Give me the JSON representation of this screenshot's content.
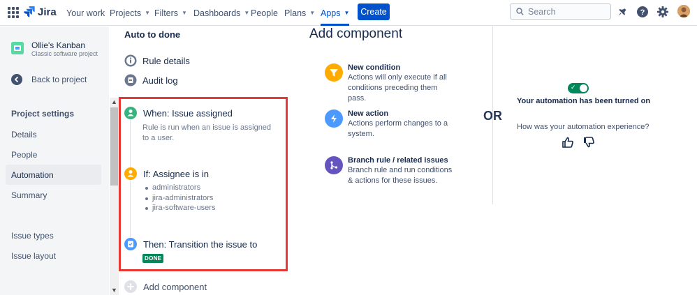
{
  "nav": {
    "logo": "Jira",
    "items": [
      {
        "label": "Your work",
        "dropdown": false
      },
      {
        "label": "Projects",
        "dropdown": true
      },
      {
        "label": "Filters",
        "dropdown": true
      },
      {
        "label": "Dashboards",
        "dropdown": true
      },
      {
        "label": "People",
        "dropdown": false
      },
      {
        "label": "Plans",
        "dropdown": true
      },
      {
        "label": "Apps",
        "dropdown": true,
        "active": true
      }
    ],
    "create_label": "Create",
    "search_placeholder": "Search",
    "accent_color": "#0052CC"
  },
  "sidebar": {
    "project_name": "Ollie's Kanban",
    "project_type": "Classic software project",
    "back_label": "Back to project",
    "heading": "Project settings",
    "items": [
      {
        "label": "Details"
      },
      {
        "label": "People"
      },
      {
        "label": "Automation",
        "selected": true
      },
      {
        "label": "Summary"
      },
      {
        "label": "Issue types"
      },
      {
        "label": "Issue layout"
      }
    ]
  },
  "rule": {
    "title": "Auto to done",
    "details_label": "Rule details",
    "audit_label": "Audit log",
    "trigger": {
      "title": "When: Issue assigned",
      "description": "Rule is run when an issue is assigned to a user."
    },
    "condition": {
      "title": "If: Assignee is in",
      "groups": [
        "administrators",
        "jira-administrators",
        "jira-software-users"
      ]
    },
    "action": {
      "title": "Then: Transition the issue to",
      "status": "DONE"
    },
    "add_component_label": "Add component",
    "highlight_color": "#E53935"
  },
  "add_component": {
    "title": "Add component",
    "options": [
      {
        "title": "New condition",
        "description": "Actions will only execute if all conditions preceding them pass.",
        "icon": "filter-icon",
        "color": "#FFAB00"
      },
      {
        "title": "New action",
        "description": "Actions perform changes to a system.",
        "icon": "lightning-icon",
        "color": "#4C9AFF"
      },
      {
        "title": "Branch rule / related issues",
        "description": "Branch rule and run conditions & actions for these issues.",
        "icon": "branch-icon",
        "color": "#6554C0"
      }
    ],
    "or_label": "OR"
  },
  "feedback": {
    "status": "Your automation has been turned on",
    "question": "How was your automation experience?",
    "toggle_on": true,
    "toggle_color": "#00875A"
  }
}
